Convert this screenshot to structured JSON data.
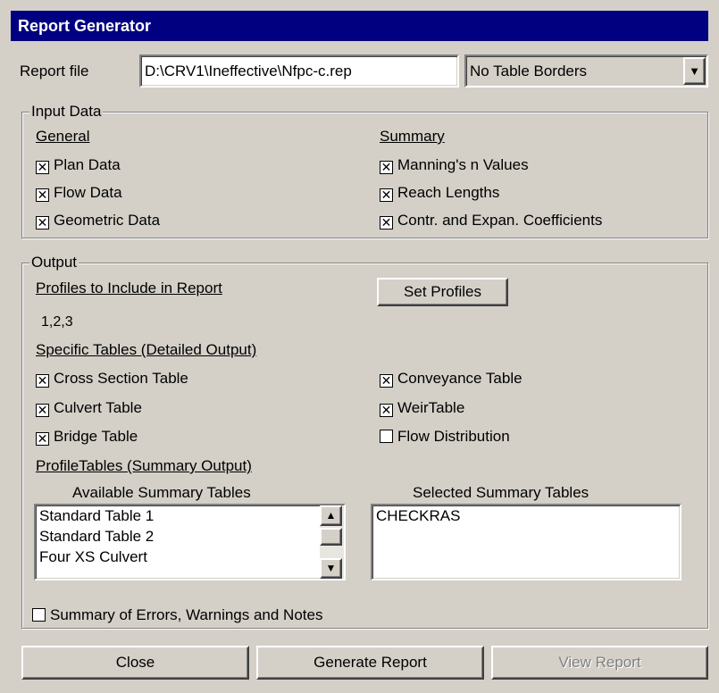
{
  "window": {
    "title": "Report Generator"
  },
  "report_file": {
    "label": "Report file",
    "value": "D:\\CRV1\\Ineffective\\Nfpc-c.rep",
    "border_select": "No Table Borders"
  },
  "input_data": {
    "group_label": "Input Data",
    "general": {
      "heading": "General",
      "items": [
        {
          "label": "Plan Data",
          "checked": true
        },
        {
          "label": "Flow Data",
          "checked": true
        },
        {
          "label": "Geometric Data",
          "checked": true
        }
      ]
    },
    "summary": {
      "heading": "Summary",
      "items": [
        {
          "label": "Manning's n Values",
          "checked": true
        },
        {
          "label": "Reach Lengths",
          "checked": true
        },
        {
          "label": "Contr. and Expan. Coefficients",
          "checked": true
        }
      ]
    }
  },
  "output": {
    "group_label": "Output",
    "profiles_heading": "Profiles to Include in Report",
    "profiles_value": "1,2,3",
    "set_profiles_label": "Set Profiles",
    "specific_heading": "Specific Tables (Detailed Output)",
    "specific_left": [
      {
        "label": "Cross Section Table",
        "checked": true
      },
      {
        "label": "Culvert Table",
        "checked": true
      },
      {
        "label": "Bridge Table",
        "checked": true
      }
    ],
    "specific_right": [
      {
        "label": "Conveyance Table",
        "checked": true
      },
      {
        "label": "WeirTable",
        "checked": true
      },
      {
        "label": "Flow Distribution",
        "checked": false
      }
    ],
    "profile_tables_heading": "ProfileTables (Summary Output)",
    "available_heading": "Available Summary Tables",
    "available_items": [
      "Standard Table 1",
      "Standard Table 2",
      "Four XS Culvert"
    ],
    "selected_heading": "Selected Summary Tables",
    "selected_items": [
      "CHECKRAS"
    ],
    "errors_summary": {
      "label": "Summary of Errors, Warnings and Notes",
      "checked": false
    }
  },
  "buttons": {
    "close": "Close",
    "generate": "Generate Report",
    "view": "View Report"
  }
}
